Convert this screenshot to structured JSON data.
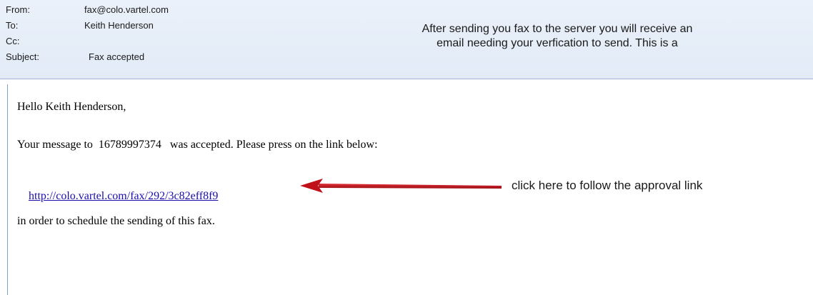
{
  "header": {
    "from_label": "From:",
    "from_value": "fax@colo.vartel.com",
    "to_label": "To:",
    "to_value": "Keith Henderson",
    "cc_label": "Cc:",
    "cc_value": "",
    "subject_label": "Subject:",
    "subject_value": "Fax accepted"
  },
  "callout": {
    "text": "After sending you fax to the server you will receive  an\nemail needing your verfication to send.  This is a"
  },
  "message": {
    "greeting": "Hello Keith Henderson,",
    "line1": "Your message to  16789997374   was accepted. Please press on the link below:",
    "link": "http://colo.vartel.com/fax/292/3c82eff8f9",
    "line2": "in order to schedule the sending of this fax."
  },
  "annotation": {
    "note": "click here to follow the approval link",
    "arrow_color": "#c0111a"
  }
}
